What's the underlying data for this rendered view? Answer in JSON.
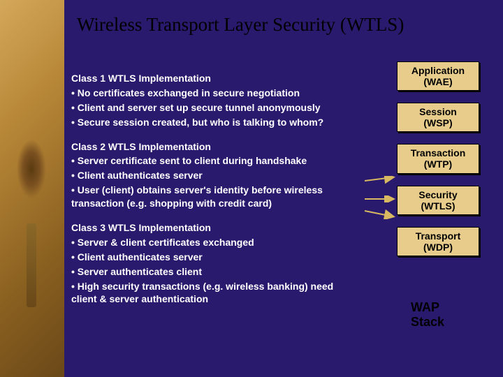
{
  "title": "Wireless Transport Layer Security (WTLS)",
  "content": {
    "class1": {
      "heading": "Class 1 WTLS Implementation",
      "b1": "•  No certificates exchanged in secure negotiation",
      "b2": "•  Client and server set up secure tunnel anonymously",
      "b3": "•  Secure session created, but who is talking to whom?"
    },
    "class2": {
      "heading": "Class 2 WTLS Implementation",
      "b1": "•  Server certificate sent to client during handshake",
      "b2": "•  Client authenticates server",
      "b3": "•  User (client) obtains server's identity before wireless transaction (e.g. shopping with credit card)"
    },
    "class3": {
      "heading": "Class 3 WTLS Implementation",
      "b1": "•  Server & client certificates exchanged",
      "b2": "•  Client authenticates server",
      "b3": "•  Server authenticates client",
      "b4": "•  High security transactions (e.g. wireless banking) need client & server authentication"
    }
  },
  "stack": {
    "layers": [
      {
        "line1": "Application",
        "line2": "(WAE)"
      },
      {
        "line1": "Session",
        "line2": "(WSP)"
      },
      {
        "line1": "Transaction",
        "line2": "(WTP)"
      },
      {
        "line1": "Security",
        "line2": "(WTLS)"
      },
      {
        "line1": "Transport",
        "line2": "(WDP)"
      }
    ],
    "label_l1": "WAP",
    "label_l2": "Stack"
  }
}
